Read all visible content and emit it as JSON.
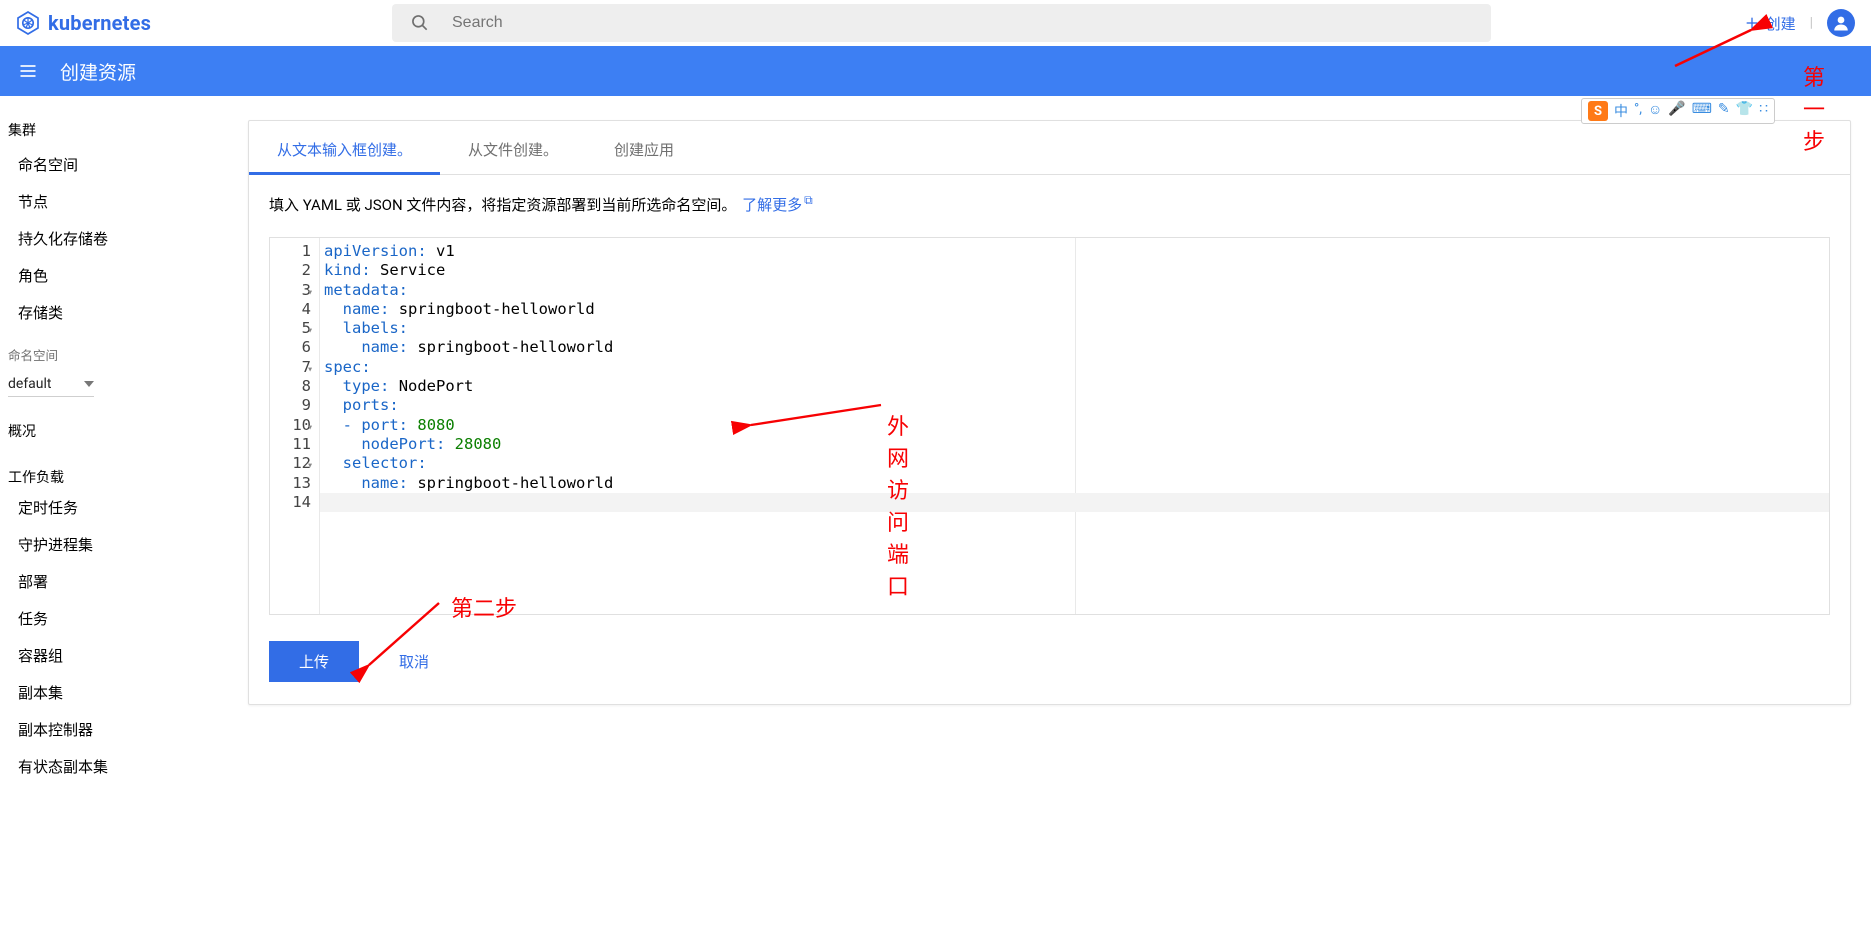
{
  "header": {
    "brand": "kubernetes",
    "search_placeholder": "Search",
    "create_label": "创建"
  },
  "bluebar": {
    "title": "创建资源"
  },
  "sidebar": {
    "cluster_head": "集群",
    "cluster_items": [
      "命名空间",
      "节点",
      "持久化存储卷",
      "角色",
      "存储类"
    ],
    "ns_label": "命名空间",
    "ns_selected": "default",
    "overview": "概况",
    "workload_head": "工作负载",
    "workload_items": [
      "定时任务",
      "守护进程集",
      "部署",
      "任务",
      "容器组",
      "副本集",
      "副本控制器",
      "有状态副本集"
    ]
  },
  "tabs": {
    "t0": "从文本输入框创建。",
    "t1": "从文件创建。",
    "t2": "创建应用"
  },
  "desc": {
    "text": "填入 YAML 或 JSON 文件内容，将指定资源部署到当前所选命名空间。",
    "link": "了解更多"
  },
  "editor": {
    "lines": [
      {
        "n": 1,
        "fold": false,
        "seg": [
          [
            "apiVersion:",
            "k"
          ],
          [
            " ",
            ""
          ],
          [
            "v1",
            "s"
          ]
        ]
      },
      {
        "n": 2,
        "fold": false,
        "seg": [
          [
            "kind:",
            "k"
          ],
          [
            " ",
            ""
          ],
          [
            "Service",
            "s"
          ]
        ]
      },
      {
        "n": 3,
        "fold": true,
        "seg": [
          [
            "metadata:",
            "k"
          ]
        ]
      },
      {
        "n": 4,
        "fold": false,
        "seg": [
          [
            "  ",
            ""
          ],
          [
            "name:",
            "k"
          ],
          [
            " ",
            ""
          ],
          [
            "springboot-helloworld",
            "s"
          ]
        ]
      },
      {
        "n": 5,
        "fold": true,
        "seg": [
          [
            "  ",
            ""
          ],
          [
            "labels:",
            "k"
          ]
        ]
      },
      {
        "n": 6,
        "fold": false,
        "seg": [
          [
            "    ",
            ""
          ],
          [
            "name:",
            "k"
          ],
          [
            " ",
            ""
          ],
          [
            "springboot-helloworld",
            "s"
          ]
        ]
      },
      {
        "n": 7,
        "fold": true,
        "seg": [
          [
            "spec:",
            "k"
          ]
        ]
      },
      {
        "n": 8,
        "fold": false,
        "seg": [
          [
            "  ",
            ""
          ],
          [
            "type:",
            "k"
          ],
          [
            " ",
            ""
          ],
          [
            "NodePort",
            "s"
          ]
        ]
      },
      {
        "n": 9,
        "fold": false,
        "seg": [
          [
            "  ",
            ""
          ],
          [
            "ports:",
            "k"
          ]
        ]
      },
      {
        "n": 10,
        "fold": true,
        "seg": [
          [
            "  ",
            ""
          ],
          [
            "- ",
            "k"
          ],
          [
            "port:",
            "k"
          ],
          [
            " ",
            ""
          ],
          [
            "8080",
            "v"
          ]
        ]
      },
      {
        "n": 11,
        "fold": false,
        "seg": [
          [
            "    ",
            ""
          ],
          [
            "nodePort:",
            "k"
          ],
          [
            " ",
            ""
          ],
          [
            "28080",
            "v"
          ]
        ]
      },
      {
        "n": 12,
        "fold": true,
        "seg": [
          [
            "  ",
            ""
          ],
          [
            "selector:",
            "k"
          ]
        ]
      },
      {
        "n": 13,
        "fold": false,
        "seg": [
          [
            "    ",
            ""
          ],
          [
            "name:",
            "k"
          ],
          [
            " ",
            ""
          ],
          [
            "springboot-helloworld",
            "s"
          ]
        ]
      },
      {
        "n": 14,
        "fold": false,
        "seg": [
          [
            "",
            ""
          ]
        ]
      }
    ],
    "cursor_line_index": 13
  },
  "actions": {
    "upload": "上传",
    "cancel": "取消"
  },
  "annotations": {
    "step1": "第一步",
    "port_note": "外网访问端口",
    "step2": "第二步"
  },
  "ime": {
    "logo": "S",
    "items": [
      "中",
      "°,",
      "☺",
      "🎤",
      "⌨",
      "✎",
      "👕",
      "∷"
    ]
  }
}
